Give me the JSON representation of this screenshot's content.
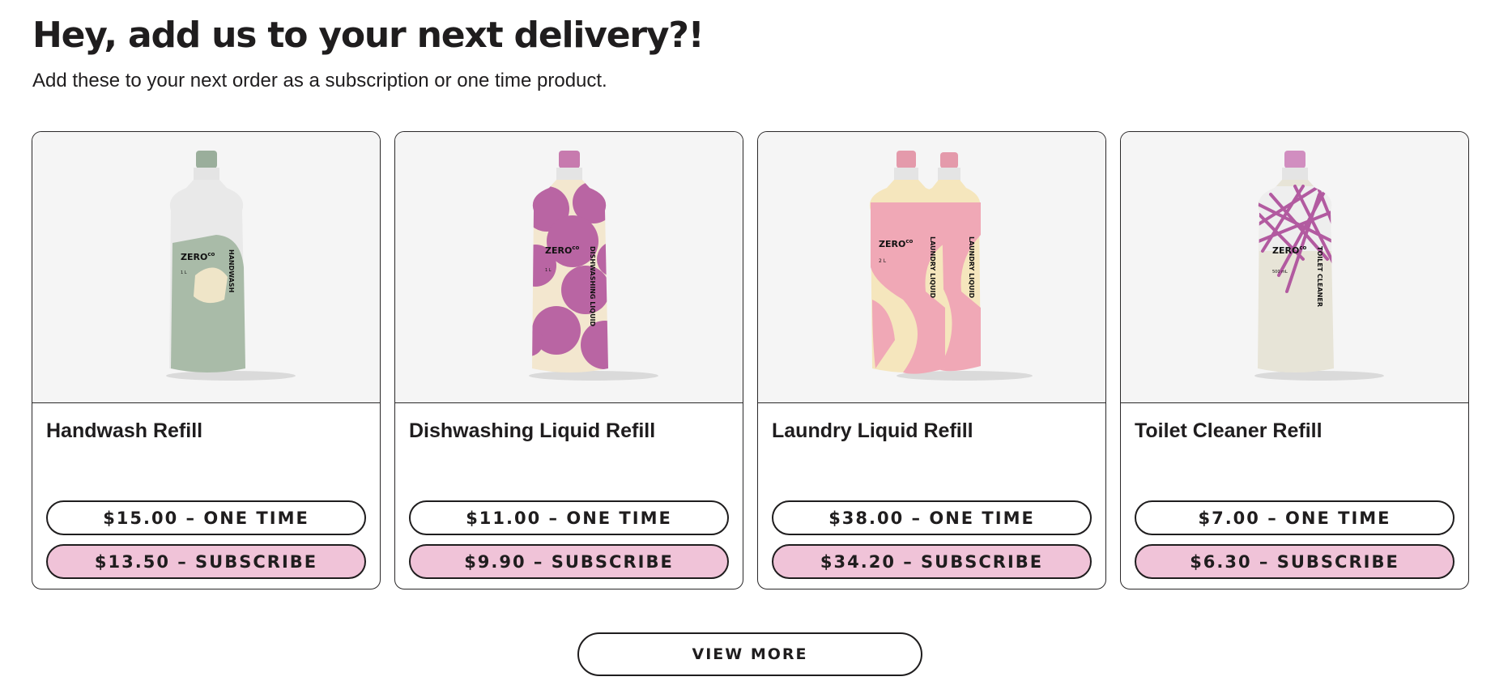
{
  "header": {
    "title": "Hey, add us to your next delivery?!",
    "subtitle": "Add these to your next order as a subscription or one time product."
  },
  "products": [
    {
      "name": "Handwash Refill",
      "one_time_label": "$15.00 – ONE TIME",
      "subscribe_label": "$13.50 – SUBSCRIBE",
      "image": {
        "brand": "ZERO",
        "brand_mark": "co",
        "product_label": "HANDWASH",
        "volume": "1 L",
        "cap_color": "#9aae9b",
        "accent_color": "#a9bba8",
        "fill_color": "#efe5c8"
      }
    },
    {
      "name": "Dishwashing Liquid Refill",
      "one_time_label": "$11.00 – ONE TIME",
      "subscribe_label": "$9.90 – SUBSCRIBE",
      "image": {
        "brand": "ZERO",
        "brand_mark": "co",
        "product_label": "DISHWASHING LIQUID",
        "volume": "1 L",
        "cap_color": "#c77aae",
        "accent_color": "#b965a3",
        "fill_color": "#f3e7cf"
      }
    },
    {
      "name": "Laundry Liquid Refill",
      "one_time_label": "$38.00 – ONE TIME",
      "subscribe_label": "$34.20 – SUBSCRIBE",
      "image": {
        "brand": "ZERO",
        "brand_mark": "co",
        "product_label": "LAUNDRY LIQUID",
        "volume": "2 L",
        "cap_color": "#e49aab",
        "accent_color": "#f0a8b6",
        "fill_color": "#f5e6bd"
      }
    },
    {
      "name": "Toilet Cleaner Refill",
      "one_time_label": "$7.00 – ONE TIME",
      "subscribe_label": "$6.30 – SUBSCRIBE",
      "image": {
        "brand": "ZERO",
        "brand_mark": "co",
        "product_label": "TOILET CLEANER",
        "volume": "500 mL",
        "cap_color": "#d18ec0",
        "accent_color": "#b25aa0",
        "fill_color": "#e7e4d7"
      }
    }
  ],
  "view_more_label": "VIEW MORE"
}
